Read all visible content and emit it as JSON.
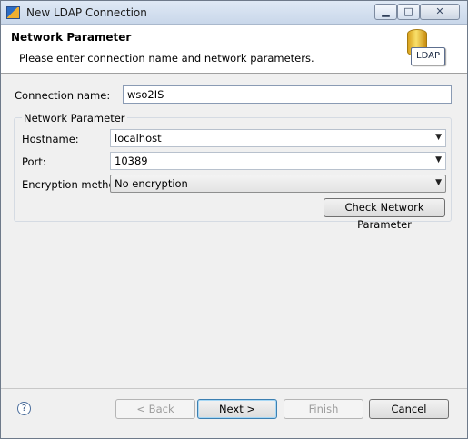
{
  "window": {
    "title": "New LDAP Connection"
  },
  "header": {
    "title": "Network Parameter",
    "description": "Please enter connection name and network parameters.",
    "logo_text": "LDAP"
  },
  "form": {
    "connection_name_label": "Connection name:",
    "connection_name_value": "wso2IS",
    "group_title": "Network Parameter",
    "hostname_label": "Hostname:",
    "hostname_value": "localhost",
    "port_label": "Port:",
    "port_value": "10389",
    "encryption_label": "Encryption method:",
    "encryption_value": "No encryption",
    "check_button": "Check Network Parameter"
  },
  "footer": {
    "help": "?",
    "back": "< Back",
    "next": "Next >",
    "finish_first": "F",
    "finish_rest": "inish",
    "cancel": "Cancel"
  },
  "icons": {
    "titlebar": "eclipse-app-icon",
    "logo": "ldap-database-icon",
    "dropdown": "chevron-down-icon",
    "help": "help-icon"
  }
}
